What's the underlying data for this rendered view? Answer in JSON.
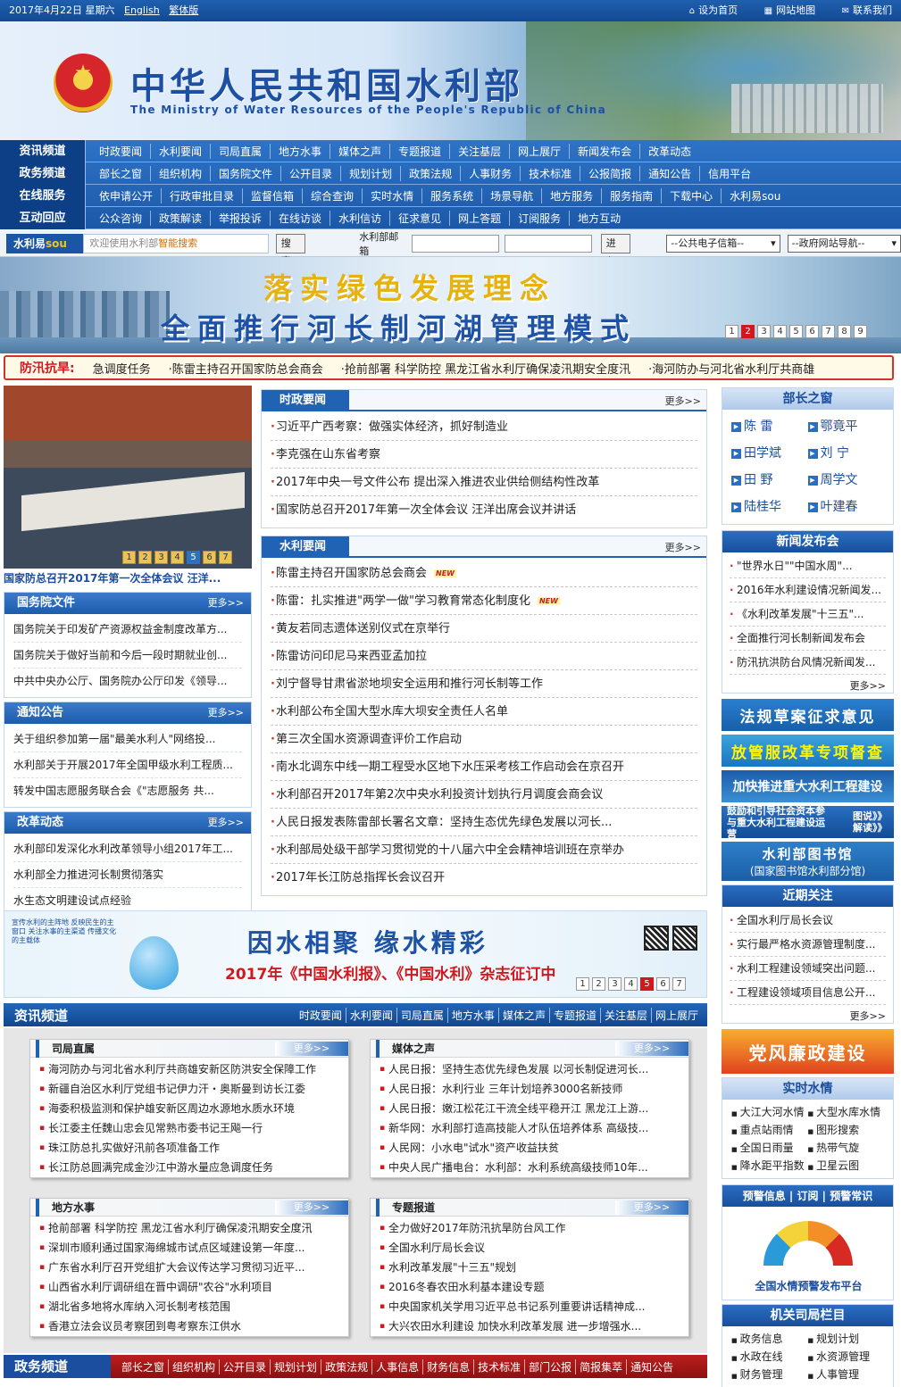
{
  "topbar": {
    "date": "2017年4月22日 星期六",
    "english": "English",
    "traditional": "繁体版",
    "set_home": "设为首页",
    "site_map": "网站地图",
    "contact": "联系我们"
  },
  "header": {
    "title_cn": "中华人民共和国水利部",
    "title_en": "The Ministry of Water Resources of the People's Republic of China"
  },
  "nav": [
    {
      "title": "资讯频道",
      "items": [
        "时政要闻",
        "水利要闻",
        "司局直属",
        "地方水事",
        "媒体之声",
        "专题报道",
        "关注基层",
        "网上展厅",
        "新闻发布会",
        "改革动态"
      ]
    },
    {
      "title": "政务频道",
      "items": [
        "部长之窗",
        "组织机构",
        "国务院文件",
        "公开目录",
        "规划计划",
        "政策法规",
        "人事财务",
        "技术标准",
        "公报简报",
        "通知公告",
        "信用平台"
      ]
    },
    {
      "title": "在线服务",
      "items": [
        "依申请公开",
        "行政审批目录",
        "监督信箱",
        "综合查询",
        "实时水情",
        "服务系统",
        "场景导航",
        "地方服务",
        "服务指南",
        "下载中心",
        "水利易sou"
      ]
    },
    {
      "title": "互动回应",
      "items": [
        "公众咨询",
        "政策解读",
        "举报投诉",
        "在线访谈",
        "水利信访",
        "征求意见",
        "网上答题",
        "订阅服务",
        "地方互动"
      ]
    }
  ],
  "search": {
    "logo": "水利易",
    "logo_suffix": "sou",
    "placeholder": "欢迎使用水利部",
    "placeholder_hl": "智能搜索",
    "button": "搜索",
    "mail_label": "水利部邮箱",
    "enter": "进入",
    "select1": "--公共电子信箱--",
    "select2": "--政府网站导航--"
  },
  "slide": {
    "line1": "落实绿色发展理念",
    "line2": "全面推行河长制河湖管理模式",
    "pages": [
      "1",
      "2",
      "3",
      "4",
      "5",
      "6",
      "7",
      "8",
      "9"
    ],
    "active_page": "2"
  },
  "ticker": {
    "label": "防汛抗旱:",
    "items": [
      "急调度任务",
      "·陈雷主持召开国家防总会商会",
      "·抢前部署 科学防控 黑龙江省水利厅确保凌汛期安全度汛",
      "·海河防办与河北省水利厅共商雄"
    ]
  },
  "photo": {
    "caption": "国家防总召开2017年第一次全体会议 汪洋...",
    "pages": [
      "1",
      "2",
      "3",
      "4",
      "5",
      "6",
      "7"
    ],
    "active_page": "5"
  },
  "left_boxes": [
    {
      "title": "国务院文件",
      "more": "更多>>",
      "items": [
        "国务院关于印发矿产资源权益金制度改革方...",
        "国务院关于做好当前和今后一段时期就业创...",
        "中共中央办公厅、国务院办公厅印发《领导..."
      ]
    },
    {
      "title": "通知公告",
      "more": "更多>>",
      "items": [
        "关于组织参加第一届\"最美水利人\"网络投...",
        "水利部关于开展2017年全国甲级水利工程质...",
        "转发中国志愿服务联合会《\"志愿服务 共..."
      ]
    },
    {
      "title": "改革动态",
      "more": "更多>>",
      "items": [
        "水利部印发深化水利改革领导小组2017年工...",
        "水利部全力推进河长制贯彻落实",
        "水生态文明建设试点经验"
      ]
    }
  ],
  "mid_boxes": [
    {
      "title": "时政要闻",
      "more": "更多>>",
      "items": [
        {
          "text": "习近平广西考察：做强实体经济，抓好制造业",
          "new": ""
        },
        {
          "text": "李克强在山东省考察",
          "new": ""
        },
        {
          "text": "2017年中央一号文件公布 提出深入推进农业供给侧结构性改革",
          "new": ""
        },
        {
          "text": "国家防总召开2017年第一次全体会议 汪洋出席会议并讲话",
          "new": ""
        }
      ]
    },
    {
      "title": "水利要闻",
      "more": "更多>>",
      "items": [
        {
          "text": "陈雷主持召开国家防总会商会",
          "new": "NEW"
        },
        {
          "text": "陈雷：扎实推进\"两学一做\"学习教育常态化制度化",
          "new": "NEW"
        },
        {
          "text": "黄友若同志遗体送别仪式在京举行",
          "new": ""
        },
        {
          "text": "陈雷访问印尼马来西亚孟加拉",
          "new": ""
        },
        {
          "text": "刘宁督导甘肃省淤地坝安全运用和推行河长制等工作",
          "new": ""
        },
        {
          "text": "水利部公布全国大型水库大坝安全责任人名单",
          "new": ""
        },
        {
          "text": "第三次全国水资源调查评价工作启动",
          "new": ""
        },
        {
          "text": "南水北调东中线一期工程受水区地下水压采考核工作启动会在京召开",
          "new": ""
        },
        {
          "text": "水利部召开2017年第2次中央水利投资计划执行月调度会商会议",
          "new": ""
        },
        {
          "text": "人民日报发表陈雷部长署名文章：坚持生态优先绿色发展以河长...",
          "new": ""
        },
        {
          "text": "水利部局处级干部学习贯彻党的十八届六中全会精神培训班在京举办",
          "new": ""
        },
        {
          "text": "2017年长江防总指挥长会议召开",
          "new": ""
        }
      ]
    }
  ],
  "ad": {
    "slogan_small": "宣传水利的主阵地 反映民生的主窗口 关注水事的主渠道 传播文化的主载体",
    "title": "因水相聚 缘水精彩",
    "subtitle": "2017年《中国水利报》、《中国水利》杂志征订中",
    "pages": [
      "1",
      "2",
      "3",
      "4",
      "5",
      "6",
      "7"
    ],
    "active_page": "5"
  },
  "news_channel": {
    "title": "资讯频道",
    "items": [
      "时政要闻",
      "水利要闻",
      "司局直属",
      "地方水事",
      "媒体之声",
      "专题报道",
      "关注基层",
      "网上展厅"
    ],
    "boxes": [
      {
        "title": "司局直属",
        "more": "更多>>",
        "items": [
          "海河防办与河北省水利厅共商雄安新区防洪安全保障工作",
          "新疆自治区水利厅党组书记伊力汗・奥斯曼到访长江委",
          "海委积极监测和保护雄安新区周边水源地水质水环境",
          "长江委主任魏山忠会见常熟市委书记王飚一行",
          "珠江防总扎实做好汛前各项准备工作",
          "长江防总圆满完成金沙江中游水量应急调度任务"
        ]
      },
      {
        "title": "媒体之声",
        "more": "更多>>",
        "items": [
          "人民日报：坚持生态优先绿色发展 以河长制促进河长...",
          "人民日报：水利行业 三年计划培养3000名新技师",
          "人民日报：嫩江松花江干流全线平稳开江 黑龙江上游...",
          "新华网：水利部打造高技能人才队伍培养体系 高级技...",
          "人民网：小水电\"试水\"资产收益扶贫",
          "中央人民广播电台：水利部：水利系统高级技师10年..."
        ]
      },
      {
        "title": "地方水事",
        "more": "更多>>",
        "items": [
          "抢前部署 科学防控 黑龙江省水利厅确保凌汛期安全度汛",
          "深圳市顺利通过国家海绵城市试点区域建设第一年度...",
          "广东省水利厅召开党组扩大会议传达学习贯彻习近平...",
          "山西省水利厅调研组在晋中调研\"农谷\"水利项目",
          "湖北省多地将水库纳入河长制考核范围",
          "香港立法会议员考察团到粤考察东江供水"
        ]
      },
      {
        "title": "专题报道",
        "more": "更多>>",
        "items": [
          "全力做好2017年防汛抗旱防台风工作",
          "全国水利厅局长会议",
          "水利改革发展\"十三五\"规划",
          "2016冬春农田水利基本建设专题",
          "中央国家机关学用习近平总书记系列重要讲话精神成...",
          "大兴农田水利建设 加快水利改革发展 进一步增强水..."
        ]
      }
    ]
  },
  "gov_channel": {
    "title": "政务频道",
    "items": [
      "部长之窗",
      "组织机构",
      "公开目录",
      "规划计划",
      "政策法规",
      "人事信息",
      "财务信息",
      "技术标准",
      "部门公报",
      "简报集萃",
      "通知公告"
    ]
  },
  "right": {
    "leaders_title": "部长之窗",
    "leaders": [
      "陈 雷",
      "鄂竟平",
      "田学斌",
      "刘 宁",
      "田 野",
      "周学文",
      "陆桂华",
      "叶建春"
    ],
    "press_title": "新闻发布会",
    "press_items": [
      "\"世界水日\"\"中国水周\"...",
      "2016年水利建设情况新闻发...",
      "《水利改革发展\"十三五\"...",
      "全面推行河长制新闻发布会",
      "防汛抗洪防台风情况新闻发..."
    ],
    "more": "更多>>",
    "banner_law": "法规草案征求意见",
    "banner_reform": "放管服改革专项督查",
    "banner_project": "加快推进重大水利工程建设",
    "banner_capital_l": "鼓励和引导社会资本参与重大水利工程建设运营",
    "banner_capital_r": "图说》》 解读》》",
    "library_title": "水利部图书馆",
    "library_sub": "(国家图书馆水利部分馆)",
    "recent_title": "近期关注",
    "recent_items": [
      "全国水利厅局长会议",
      "实行最严格水资源管理制度...",
      "水利工程建设领域突出问题...",
      "工程建设领域项目信息公开..."
    ],
    "party_banner": "党风廉政建设",
    "water_title": "实时水情",
    "water_items": [
      "大江大河水情",
      "大型水库水情",
      "重点站雨情",
      "图形搜索",
      "全国日雨量",
      "热带气旋",
      "降水距平指数",
      "卫星云图"
    ],
    "forecast_tabs": "预警信息 | 订阅 | 预警常识",
    "forecast_title": "全国水情预警发布平台",
    "dept_title": "机关司局栏目",
    "dept_items": [
      "政务信息",
      "规划计划",
      "水政在线",
      "水资源管理",
      "财务管理",
      "人事管理"
    ]
  },
  "colors": {
    "brand_blue": "#1b56a6",
    "accent_red": "#d0191f",
    "highlight_yellow": "#e6b20e"
  }
}
